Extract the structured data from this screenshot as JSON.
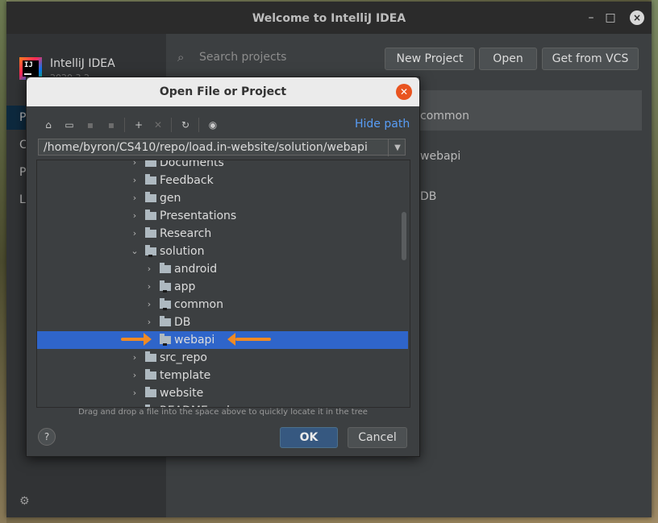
{
  "window": {
    "title": "Welcome to IntelliJ IDEA",
    "controls": {
      "minimize": "–",
      "maximize": "□",
      "close": "×"
    }
  },
  "sidebar": {
    "app_name": "IntelliJ IDEA",
    "app_version": "2020.3.2",
    "logo_text": "IJ",
    "nav": [
      "P",
      "C",
      "P",
      "L"
    ]
  },
  "welcome": {
    "search_placeholder": "Search projects",
    "buttons": {
      "new_project": "New Project",
      "open": "Open",
      "get_from_vcs": "Get from VCS"
    },
    "projects": [
      "common",
      "webapi",
      "DB"
    ]
  },
  "dialog": {
    "title": "Open File or Project",
    "hide_path": "Hide path",
    "path": "/home/byron/CS410/repo/load.in-website/solution/webapi",
    "tree": [
      {
        "name": "Documents",
        "expanded": false
      },
      {
        "name": "Feedback",
        "expanded": false
      },
      {
        "name": "gen",
        "expanded": false
      },
      {
        "name": "Presentations",
        "expanded": false
      },
      {
        "name": "Research",
        "expanded": false
      },
      {
        "name": "solution",
        "expanded": true
      },
      {
        "name": "android",
        "expanded": false
      },
      {
        "name": "app",
        "expanded": false
      },
      {
        "name": "common",
        "expanded": false
      },
      {
        "name": "DB",
        "expanded": false
      },
      {
        "name": "webapi",
        "expanded": false,
        "selected": true
      },
      {
        "name": "src_repo",
        "expanded": false
      },
      {
        "name": "template",
        "expanded": false
      },
      {
        "name": "website",
        "expanded": false
      },
      {
        "name": "README.md",
        "expanded": false
      }
    ],
    "hint": "Drag and drop a file into the space above to quickly locate it in the tree",
    "ok": "OK",
    "cancel": "Cancel",
    "help": "?"
  },
  "colors": {
    "selection": "#2f65ca",
    "accent_link": "#589df6",
    "arrow": "#f08a24",
    "close_button": "#e95420"
  }
}
